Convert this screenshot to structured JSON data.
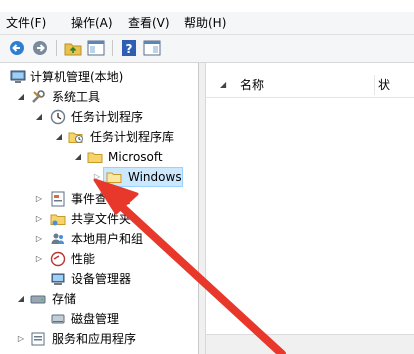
{
  "menubar": {
    "items": [
      "文件(F)",
      "操作(A)",
      "查看(V)",
      "帮助(H)"
    ]
  },
  "toolbar": {
    "icons": [
      "back-arrow-icon",
      "forward-arrow-icon",
      "up-folder-icon",
      "show-hide-tree-icon",
      "help-icon",
      "properties-icon"
    ]
  },
  "tree": {
    "root": "计算机管理(本地)",
    "system_tools": "系统工具",
    "task_scheduler": "任务计划程序",
    "task_library": "任务计划程序库",
    "microsoft": "Microsoft",
    "windows": "Windows",
    "event_viewer": "事件查看器",
    "shared_folders": "共享文件夹",
    "local_users": "本地用户和组",
    "performance": "性能",
    "device_manager": "设备管理器",
    "storage": "存储",
    "disk_management": "磁盘管理",
    "services_apps": "服务和应用程序"
  },
  "list": {
    "columns": [
      "名称",
      "状"
    ]
  },
  "colors": {
    "selection_bg": "#cce8ff",
    "selection_border": "#99d1ff",
    "annotation_arrow": "#e8372b",
    "folder_yellow": "#f6d36b"
  }
}
